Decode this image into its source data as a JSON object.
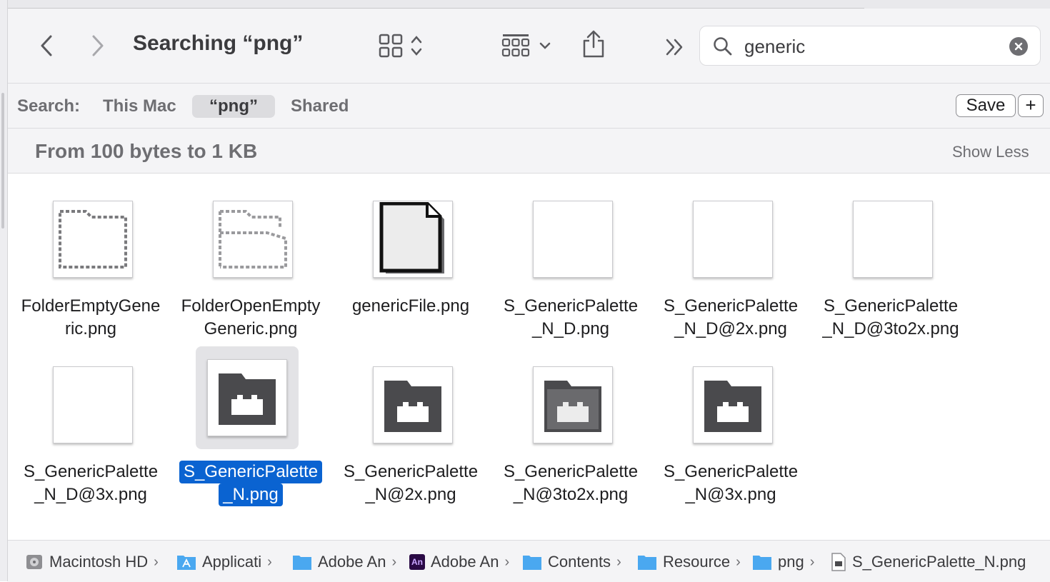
{
  "toolbar": {
    "title": "Searching “png”",
    "search_value": "generic"
  },
  "scope": {
    "label": "Search:",
    "items": [
      {
        "label": "This Mac",
        "active": false
      },
      {
        "label": "“png”",
        "active": true
      },
      {
        "label": "Shared",
        "active": false
      }
    ],
    "save_label": "Save",
    "add_label": "+"
  },
  "group": {
    "title": "From 100 bytes to 1 KB",
    "toggle_label": "Show Less"
  },
  "files": [
    {
      "line1": "FolderEmptyGene",
      "line2": "ric.png",
      "icon": "folder-empty-outline-icon",
      "selected": false
    },
    {
      "line1": "FolderOpenEmpty",
      "line2": "Generic.png",
      "icon": "folder-open-outline-icon",
      "selected": false
    },
    {
      "line1": "genericFile.png",
      "line2": "",
      "icon": "generic-file-icon",
      "selected": false
    },
    {
      "line1": "S_GenericPalette",
      "line2": "_N_D.png",
      "icon": "blank-image-icon",
      "selected": false
    },
    {
      "line1": "S_GenericPalette",
      "line2": "_N_D@2x.png",
      "icon": "blank-image-icon",
      "selected": false
    },
    {
      "line1": "S_GenericPalette",
      "line2": "_N_D@3to2x.png",
      "icon": "blank-image-icon",
      "selected": false
    },
    {
      "line1": "S_GenericPalette",
      "line2": "_N_D@3x.png",
      "icon": "blank-image-icon",
      "selected": false
    },
    {
      "line1": "S_GenericPalette",
      "line2": "_N.png",
      "icon": "palette-folder-icon",
      "selected": true
    },
    {
      "line1": "S_GenericPalette",
      "line2": "_N@2x.png",
      "icon": "palette-folder-icon",
      "selected": false
    },
    {
      "line1": "S_GenericPalette",
      "line2": "_N@3to2x.png",
      "icon": "palette-folder-icon",
      "selected": false
    },
    {
      "line1": "S_GenericPalette",
      "line2": "_N@3x.png",
      "icon": "palette-folder-icon",
      "selected": false
    }
  ],
  "path": [
    {
      "label": "Macintosh HD",
      "icon": "disk-icon"
    },
    {
      "label": "Applicati",
      "icon": "applications-folder-icon"
    },
    {
      "label": "Adobe An",
      "icon": "folder-icon"
    },
    {
      "label": "Adobe An",
      "icon": "animate-app-icon",
      "app_badge": "An"
    },
    {
      "label": "Contents",
      "icon": "folder-icon"
    },
    {
      "label": "Resource",
      "icon": "folder-icon"
    },
    {
      "label": "png",
      "icon": "folder-icon"
    },
    {
      "label": "S_GenericPalette_N.png",
      "icon": "png-file-icon"
    }
  ],
  "colors": {
    "selection": "#0a63d1",
    "folder_blue": "#4aa8f0",
    "palette_dark": "#4a4a4d"
  }
}
